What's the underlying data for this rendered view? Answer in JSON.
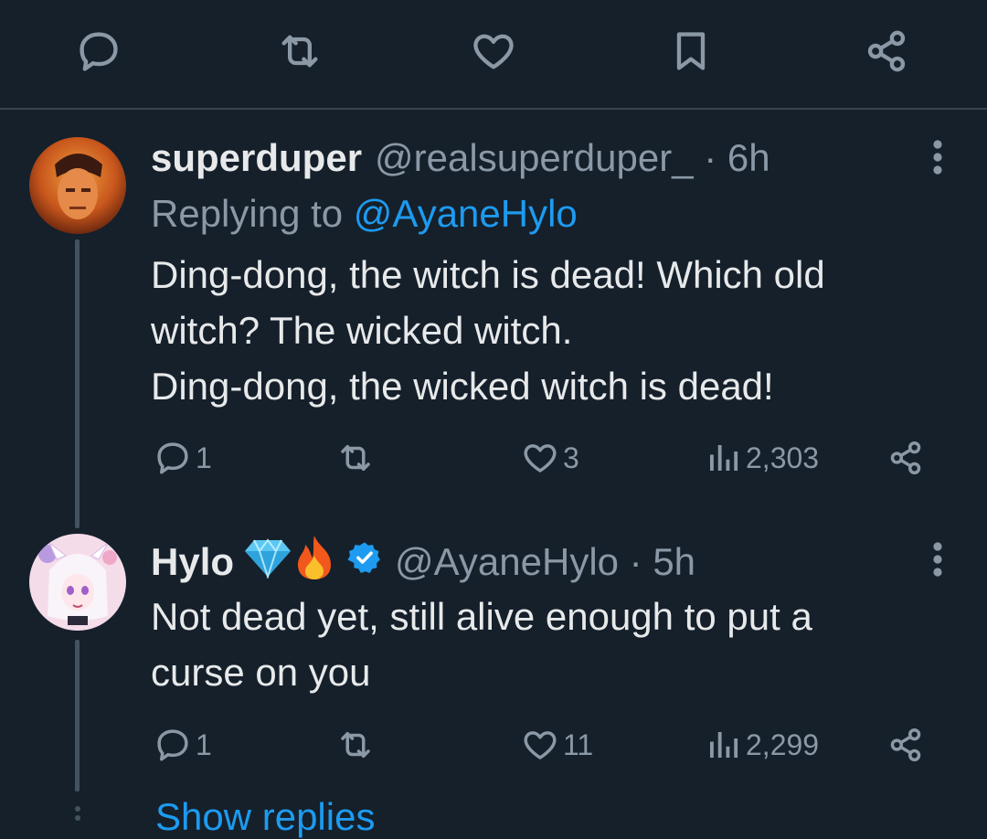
{
  "colors": {
    "background": "#15202b",
    "accent": "#1d9bf0",
    "secondary_text": "#8b98a5",
    "primary_text": "#e7e9ea",
    "divider": "#38444d"
  },
  "top_actions": [
    {
      "icon": "reply-icon"
    },
    {
      "icon": "retweet-icon"
    },
    {
      "icon": "heart-icon"
    },
    {
      "icon": "bookmark-icon"
    },
    {
      "icon": "share-icon"
    }
  ],
  "tweets": [
    {
      "name": "superduper",
      "handle": "@realsuperduper_ · 6h",
      "replying_prefix": "Replying to",
      "replying_to": "@AyaneHylo",
      "lines": [
        "Ding-dong, the witch is dead! Which old",
        "witch? The wicked witch.",
        "Ding-dong, the wicked witch is dead!"
      ],
      "replies": "1",
      "likes": "3",
      "views": "2,303"
    },
    {
      "name": "Hylo",
      "name_emojis": [
        "gem-icon",
        "fire-icon"
      ],
      "verified": true,
      "handle": "@AyaneHylo · 5h",
      "lines": [
        "Not dead yet, still alive enough to put a",
        "curse on you"
      ],
      "replies": "1",
      "likes": "11",
      "views": "2,299"
    }
  ],
  "show_replies": "Show replies"
}
